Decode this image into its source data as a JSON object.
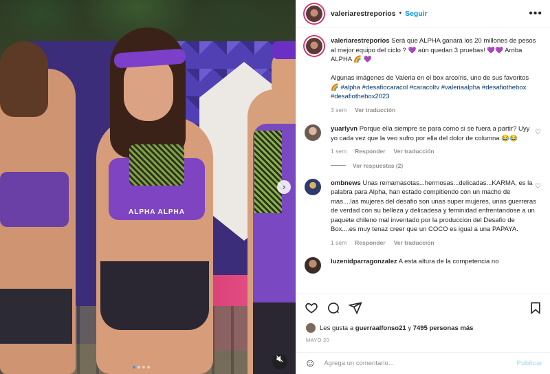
{
  "header": {
    "username": "valeriarestreporios",
    "separator": "•",
    "follow_label": "Seguir",
    "more_icon": "more-horizontal-icon"
  },
  "media": {
    "brand_text": "ALPHA ALPHA",
    "carousel_dots": 4,
    "active_dot": 1
  },
  "caption": {
    "username": "valeriarestreporios",
    "text_1": "Será que ALPHA ganará los 20 millones de pesos al mejor equipo del ciclo ? 💜 aún quedan 3 pruebas! 💜💜 Arriba ALPHA 🌈 💜",
    "text_2": "Algunas imágenes de Valeria en el box arcoíris, uno de sus favoritos 🌈",
    "hashtags": "#alpha #desafiocaracol #caracoltv #valeriaalpha #desafiothebox #desafiothebox2023",
    "time": "3 sem",
    "translate": "Ver traducción"
  },
  "comments": [
    {
      "username": "yuarlyvn",
      "text": "Porque ella siempre se para como si se fuera a partir? Uyy yo cada vez que la veo sufro por ella del dolor de columna 😂😂",
      "time": "1 sem",
      "reply": "Responder",
      "translate": "Ver traducción",
      "view_replies": "Ver respuestas (2)"
    },
    {
      "username": "ombnews",
      "text": "Unas remamasotas...hermosas...delicadas...KARMA, es la palabra para Alpha, han estado compitiendo con un macho de mas....las mujeres del desafio son unas super mujeres, unas guerreras de verdad con su belleza y delicadesa y feminidad enfrentandose a un paquete chileno mal inventado por la produccion del Desafio de Box....es muy tenaz creer que un COCO es igual a una PAPAYA.",
      "time": "1 sem",
      "reply": "Responder",
      "translate": "Ver traducción"
    },
    {
      "username": "luzenidparragonzalez",
      "text": "A esta altura de la competencia no"
    }
  ],
  "actions": {
    "likes_prefix": "Les gusta a",
    "likes_user": "guerraalfonso21",
    "likes_middle": "y",
    "likes_count": "7495 personas más",
    "date": "MAYO 20"
  },
  "add_comment": {
    "placeholder": "Agrega un comentario...",
    "post_label": "Publicar"
  },
  "colors": {
    "accent": "#0095f6",
    "hashtag": "#00376b",
    "muted": "#8e8e8e"
  }
}
